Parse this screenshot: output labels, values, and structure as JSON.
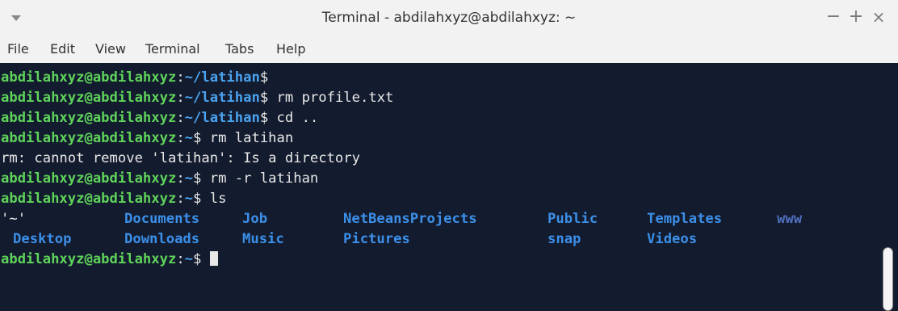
{
  "window": {
    "title": "Terminal - abdilahxyz@abdilahxyz: ~",
    "minimize_glyph": "−",
    "maximize_glyph": "+",
    "close_glyph": "×"
  },
  "menu": {
    "items": [
      "File",
      "Edit",
      "View",
      "Terminal",
      "Tabs",
      "Help"
    ]
  },
  "terminal": {
    "user_host": "abdilahxyz@abdilahxyz",
    "colon": ":",
    "dollar": "$",
    "lines": [
      {
        "path": "~/latihan",
        "cmd": ""
      },
      {
        "path": "~/latihan",
        "cmd": " rm profile.txt"
      },
      {
        "path": "~/latihan",
        "cmd": " cd .."
      },
      {
        "path": "~",
        "cmd": " rm latihan"
      },
      {
        "output": "rm: cannot remove 'latihan': Is a directory"
      },
      {
        "path": "~",
        "cmd": " rm -r latihan"
      },
      {
        "path": "~",
        "cmd": " ls"
      }
    ],
    "ls_row1": [
      "'~'",
      "Documents",
      "Job",
      "NetBeansProjects",
      "Public",
      "Templates",
      "www"
    ],
    "ls_row2": [
      "Desktop",
      "Downloads",
      "Music",
      "Pictures",
      "snap",
      "Videos"
    ],
    "last_prompt": {
      "path": "~",
      "cmd": " "
    }
  },
  "colors": {
    "background": "#131b2e",
    "user": "#5fd45a",
    "path": "#4aa3ef",
    "directory": "#3c8fe8",
    "text": "#e8e8e8"
  }
}
